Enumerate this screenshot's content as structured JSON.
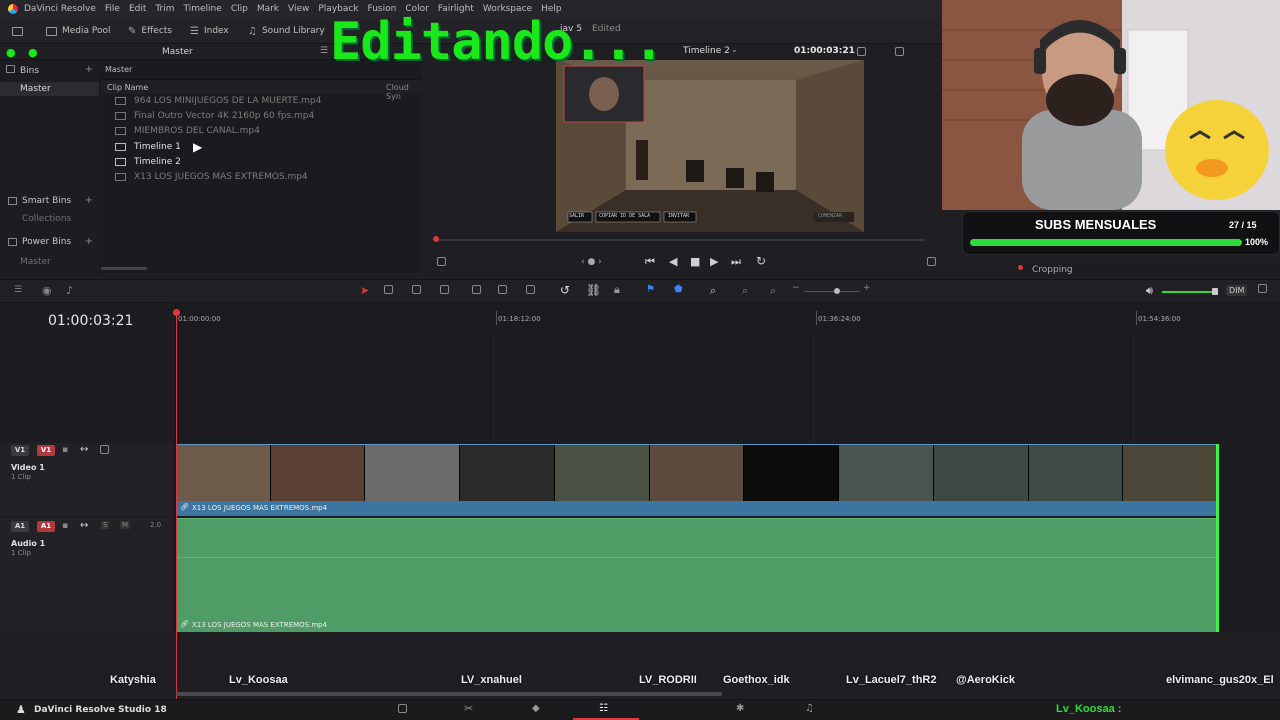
{
  "app": {
    "menu": [
      "DaVinci Resolve",
      "File",
      "Edit",
      "Trim",
      "Timeline",
      "Clip",
      "Mark",
      "View",
      "Playback",
      "Fusion",
      "Color",
      "Fairlight",
      "Workspace",
      "Help"
    ],
    "project_name": "jav 5",
    "project_status": "Edited"
  },
  "toolbar": {
    "media_pool": "Media Pool",
    "effects": "Effects",
    "index": "Index",
    "sound_library": "Sound Library",
    "pool_title": "Master"
  },
  "overlay": {
    "title": "Editando..."
  },
  "bins": {
    "header": "Bins",
    "master": "Master",
    "smart_bins": "Smart Bins",
    "collections": "Collections",
    "power_bins": "Power Bins",
    "power_master": "Master"
  },
  "media_pool": {
    "breadcrumb": "Master",
    "column_clip_name": "Clip Name",
    "column_cloud": "Cloud Syn",
    "clips": [
      {
        "name": "964 LOS MINIJUEGOS DE LA MUERTE.mp4",
        "type": "video",
        "state": "dim"
      },
      {
        "name": "Final Outro Vector 4K 2160p 60 fps.mp4",
        "type": "video",
        "state": "dim"
      },
      {
        "name": "MIEMBROS DEL CANAL.mp4",
        "type": "video",
        "state": "dim"
      },
      {
        "name": "Timeline 1",
        "type": "timeline",
        "state": "bright"
      },
      {
        "name": "Timeline 2",
        "type": "timeline",
        "state": "bright"
      },
      {
        "name": "X13 LOS JUEGOS MAS EXTREMOS.mp4",
        "type": "video",
        "state": "dim"
      }
    ]
  },
  "viewer": {
    "timeline_name": "Timeline 2",
    "timecode": "01:00:03:21",
    "game_buttons": [
      "SALIR",
      "COPIAR ID DE SALA",
      "INVITAR"
    ],
    "game_start": "COMENZAR"
  },
  "subs_widget": {
    "title": "SUBS MENSUALES",
    "count": "27 / 15",
    "percent": "100%",
    "progress": 1.0
  },
  "inspector": {
    "cropping": "Cropping"
  },
  "timeline": {
    "current_timecode": "01:00:03:21",
    "ruler_labels": [
      "01:00:00:00",
      "01:18:12:00",
      "01:36:24:00",
      "01:54:36:00"
    ],
    "volume_label": "DIM",
    "video_track": {
      "tag": "V1",
      "dest": "V1",
      "name": "Video 1",
      "clips": "1 Clip",
      "clip_name": "X13 LOS JUEGOS MAS EXTREMOS.mp4"
    },
    "audio_track": {
      "tag": "A1",
      "dest": "A1",
      "name": "Audio 1",
      "clips": "1 Clip",
      "level": "2.0",
      "clip_name": "X13 LOS JUEGOS MAS EXTREMOS.mp4"
    }
  },
  "chat": {
    "names": [
      "Katyshia",
      "Lv_Koosaa",
      "LV_xnahuel",
      "LV_RODRII",
      "Goethox_idk",
      "Lv_Lacuel7_thR2",
      "@AeroKick",
      "elvimanc_gus20x_El"
    ],
    "footer_name": "Lv_Koosaa :"
  },
  "footer": {
    "app_label": "DaVinci Resolve Studio 18"
  },
  "colors": {
    "accent_green": "#1be81b",
    "video_clip": "#3c76a0",
    "audio_clip": "#4f9c67",
    "playhead": "#e0373c"
  }
}
